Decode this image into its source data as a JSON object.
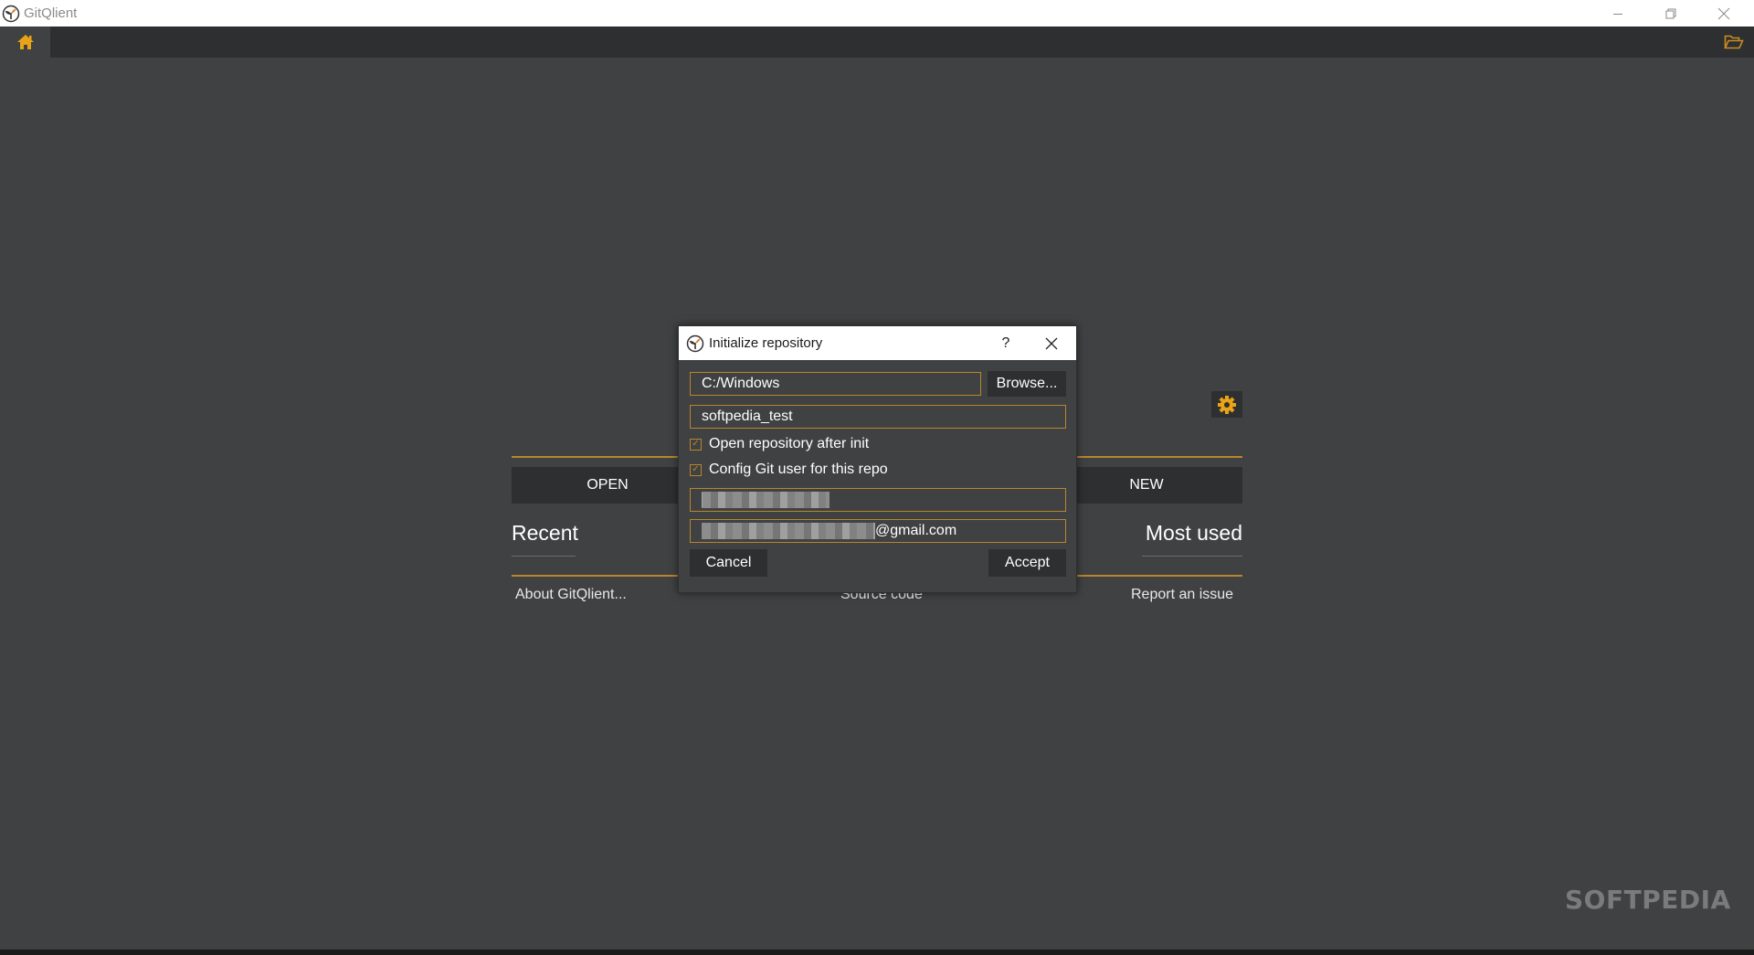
{
  "window": {
    "app_title": "GitQlient",
    "controls": {
      "minimize": "minimize-icon",
      "maximize": "restore-icon",
      "close": "close-icon"
    }
  },
  "toolbar": {
    "home_icon": "home-icon",
    "open_folder_icon": "folder-open-icon"
  },
  "home": {
    "settings_icon": "gear-icon",
    "open_label": "OPEN",
    "new_label": "NEW",
    "recent_title": "Recent",
    "most_used_title": "Most used",
    "links": {
      "about": "About GitQlient...",
      "source": "Source code",
      "issue": "Report an issue"
    }
  },
  "dialog": {
    "title": "Initialize repository",
    "help_label": "?",
    "path_value": "C:/Windows",
    "browse_label": "Browse...",
    "repo_name_value": "softpedia_test",
    "open_after_init": {
      "label": "Open repository after init",
      "checked": true
    },
    "config_git_user": {
      "label": "Config Git user for this repo",
      "checked": true
    },
    "user_name_value": "[redacted]",
    "email_suffix": "@gmail.com",
    "cancel_label": "Cancel",
    "accept_label": "Accept"
  },
  "colors": {
    "accent": "#b8862e",
    "icon_orange": "#e8a317",
    "background": "#404142",
    "button_bg": "#2e2f30"
  },
  "watermark": "SOFTPEDIA"
}
